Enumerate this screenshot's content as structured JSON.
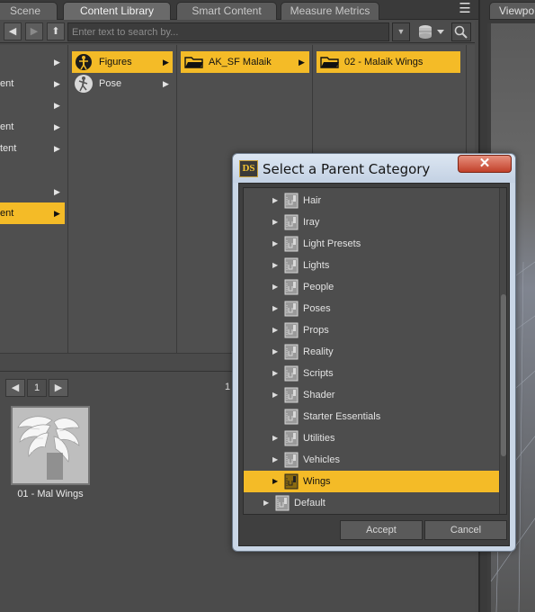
{
  "tabs": {
    "scene": "Scene",
    "content_library": "Content Library",
    "smart_content": "Smart Content",
    "measure_metrics": "Measure Metrics",
    "viewport": "Viewpo"
  },
  "toolbar": {
    "search_placeholder": "Enter text to search by..."
  },
  "browser": {
    "column1": [
      {
        "label": "",
        "selected": false
      },
      {
        "label": "ent",
        "selected": false
      },
      {
        "label": "",
        "selected": false
      },
      {
        "label": "ent",
        "selected": false
      },
      {
        "label": "tent",
        "selected": false
      },
      {
        "label": "",
        "selected": false
      },
      {
        "label": "",
        "selected": false
      },
      {
        "label": "ent",
        "selected": true
      }
    ],
    "column2": [
      {
        "label": "Figures",
        "icon": "figure-icon",
        "selected": true
      },
      {
        "label": "Pose",
        "icon": "pose-icon",
        "selected": false
      }
    ],
    "column3": [
      {
        "label": "AK_SF Malaik",
        "icon": "folder-icon",
        "selected": true
      }
    ],
    "column4": [
      {
        "label": "02 - Malaik Wings",
        "icon": "folder-icon",
        "selected": true
      }
    ]
  },
  "lower": {
    "page_number": "1",
    "page_right": "1",
    "asset_label": "01 - Mal Wings"
  },
  "dialog": {
    "app_icon_text": "DS",
    "title": "Select a Parent Category",
    "close_glyph": "✕",
    "tree": [
      {
        "label": "Hair",
        "has_children": true,
        "selected": false
      },
      {
        "label": "Iray",
        "has_children": true,
        "selected": false
      },
      {
        "label": "Light Presets",
        "has_children": true,
        "selected": false
      },
      {
        "label": "Lights",
        "has_children": true,
        "selected": false
      },
      {
        "label": "People",
        "has_children": true,
        "selected": false
      },
      {
        "label": "Poses",
        "has_children": true,
        "selected": false
      },
      {
        "label": "Props",
        "has_children": true,
        "selected": false
      },
      {
        "label": "Reality",
        "has_children": true,
        "selected": false
      },
      {
        "label": "Scripts",
        "has_children": true,
        "selected": false
      },
      {
        "label": "Shader",
        "has_children": true,
        "selected": false
      },
      {
        "label": "Starter Essentials",
        "has_children": false,
        "selected": false
      },
      {
        "label": "Utilities",
        "has_children": true,
        "selected": false
      },
      {
        "label": "Vehicles",
        "has_children": true,
        "selected": false
      },
      {
        "label": "Wings",
        "has_children": true,
        "selected": true
      },
      {
        "label": "Default",
        "has_children": true,
        "selected": false,
        "level": 0
      }
    ],
    "accept_label": "Accept",
    "cancel_label": "Cancel"
  },
  "colors": {
    "selection": "#f4bb27",
    "panel": "#4d4d4d",
    "dialog_frame": "#c9d6e6",
    "close_button": "#c2412b"
  }
}
